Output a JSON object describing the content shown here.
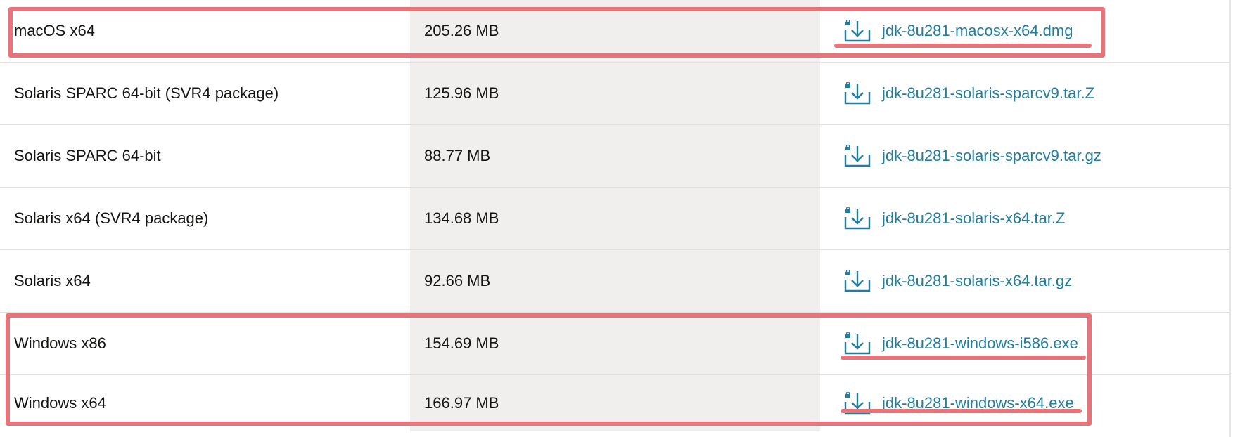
{
  "downloads": {
    "rows": [
      {
        "product": "macOS x64",
        "size": "205.26 MB",
        "file": "jdk-8u281-macosx-x64.dmg"
      },
      {
        "product": "Solaris SPARC 64-bit (SVR4 package)",
        "size": "125.96 MB",
        "file": "jdk-8u281-solaris-sparcv9.tar.Z"
      },
      {
        "product": "Solaris SPARC 64-bit",
        "size": "88.77 MB",
        "file": "jdk-8u281-solaris-sparcv9.tar.gz"
      },
      {
        "product": "Solaris x64 (SVR4 package)",
        "size": "134.68 MB",
        "file": "jdk-8u281-solaris-x64.tar.Z"
      },
      {
        "product": "Solaris x64",
        "size": "92.66 MB",
        "file": "jdk-8u281-solaris-x64.tar.gz"
      },
      {
        "product": "Windows x86",
        "size": "154.69 MB",
        "file": "jdk-8u281-windows-i586.exe"
      },
      {
        "product": "Windows x64",
        "size": "166.97 MB",
        "file": "jdk-8u281-windows-x64.exe"
      }
    ],
    "icon": "download-lock-icon",
    "colors": {
      "link": "#227e9e",
      "highlight": "#e87378",
      "size_column_bg": "#f1efed"
    }
  }
}
